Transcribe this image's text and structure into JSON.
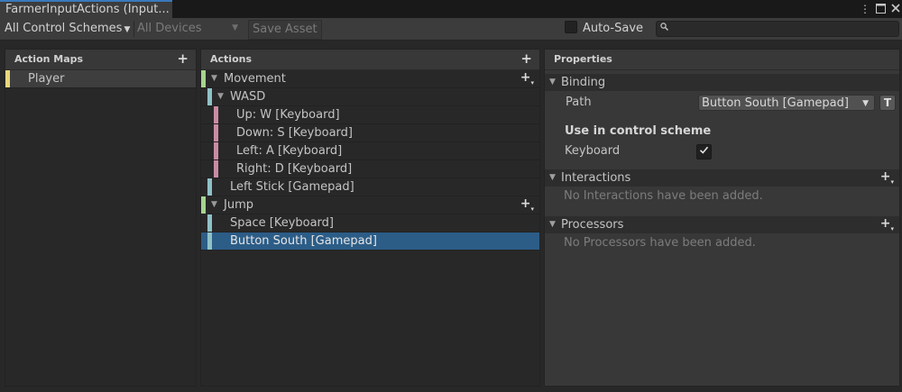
{
  "window": {
    "tab_title": "FarmerInputActions (Input...",
    "menu_icon": "kebab-menu-icon",
    "maximize_icon": "maximize-icon",
    "close_icon": "close-icon"
  },
  "toolbar": {
    "control_scheme": "All Control Schemes",
    "devices": "All Devices",
    "save_asset": "Save Asset",
    "auto_save_label": "Auto-Save",
    "auto_save_checked": false,
    "search_value": ""
  },
  "action_maps": {
    "header": "Action Maps",
    "items": [
      {
        "label": "Player",
        "color": "#e9d77d"
      }
    ]
  },
  "actions": {
    "header": "Actions",
    "rows": [
      {
        "label": "Movement",
        "kind": "action",
        "color": "#a5d48e"
      },
      {
        "label": "WASD",
        "kind": "composite",
        "color": "#8fc1c7"
      },
      {
        "label": "Up: W [Keyboard]",
        "kind": "part",
        "color": "#c98ba3"
      },
      {
        "label": "Down: S [Keyboard]",
        "kind": "part",
        "color": "#c98ba3"
      },
      {
        "label": "Left: A [Keyboard]",
        "kind": "part",
        "color": "#c98ba3"
      },
      {
        "label": "Right: D [Keyboard]",
        "kind": "part",
        "color": "#c98ba3"
      },
      {
        "label": "Left Stick [Gamepad]",
        "kind": "binding",
        "color": "#8fc1c7"
      },
      {
        "label": "Jump",
        "kind": "action",
        "color": "#a5d48e"
      },
      {
        "label": "Space [Keyboard]",
        "kind": "binding",
        "color": "#8fc1c7"
      },
      {
        "label": "Button South [Gamepad]",
        "kind": "binding",
        "color": "#8fc1c7",
        "selected": true
      }
    ]
  },
  "properties": {
    "header": "Properties",
    "binding_section": "Binding",
    "path_label": "Path",
    "path_value": "Button South [Gamepad]",
    "t_button": "T",
    "control_scheme_heading": "Use in control scheme",
    "schemes": [
      {
        "label": "Keyboard",
        "checked": true
      }
    ],
    "interactions_section": "Interactions",
    "interactions_empty": "No Interactions have been added.",
    "processors_section": "Processors",
    "processors_empty": "No Processors have been added."
  },
  "colors": {
    "selection": "#2c5d87",
    "tab_accent": "#3a79bb"
  }
}
